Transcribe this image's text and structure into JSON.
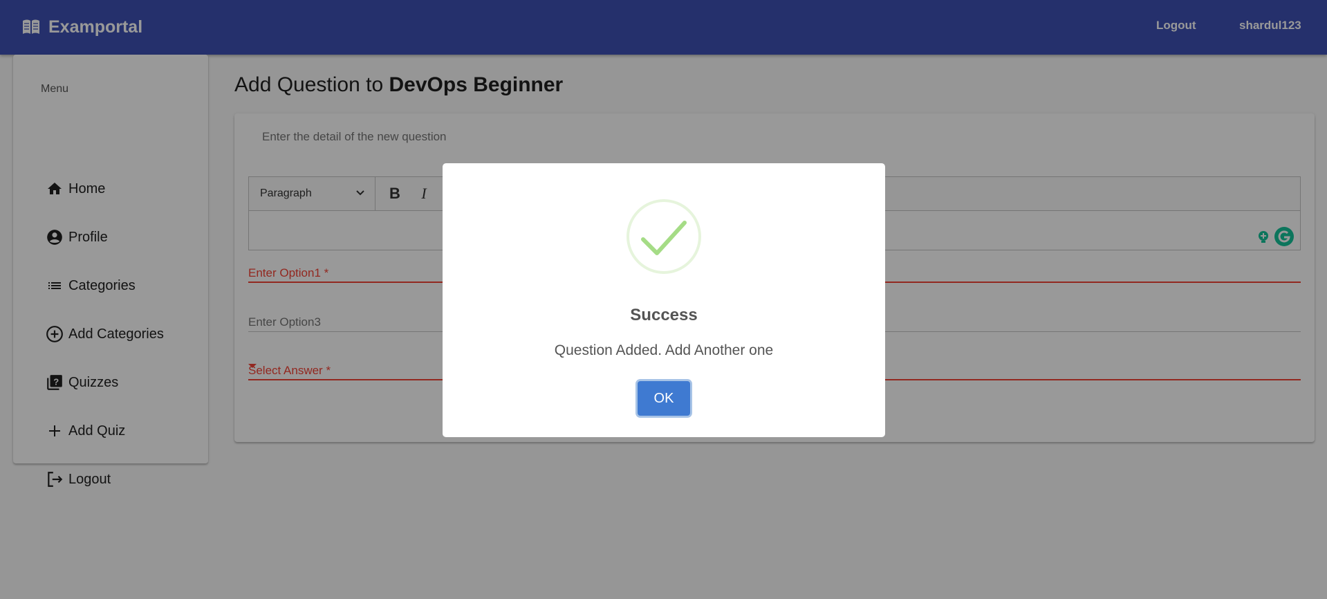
{
  "app": {
    "brand_icon": "book-icon",
    "title": "Examportal"
  },
  "header": {
    "logout_label": "Logout",
    "username": "shardul123"
  },
  "sidebar": {
    "menu_label": "Menu",
    "items": [
      {
        "label": "Home",
        "icon": "home-icon"
      },
      {
        "label": "Profile",
        "icon": "account-circle-icon"
      },
      {
        "label": "Categories",
        "icon": "list-icon"
      },
      {
        "label": "Add Categories",
        "icon": "add-circle-icon"
      },
      {
        "label": "Quizzes",
        "icon": "quiz-icon"
      },
      {
        "label": "Add Quiz",
        "icon": "plus-icon"
      },
      {
        "label": "Logout",
        "icon": "logout-icon"
      }
    ]
  },
  "main": {
    "title_prefix": "Add Question to",
    "quiz_name": "DevOps Beginner",
    "card_subtitle": "Enter the detail of the new question",
    "editor": {
      "heading_value": "Paragraph",
      "bold_label": "B",
      "italic_label": "I"
    },
    "fields": {
      "option1_placeholder": "Enter Option1 *",
      "option3_placeholder": "Enter Option3",
      "answer_placeholder": "Select Answer *"
    }
  },
  "dialog": {
    "icon": "success-check-icon",
    "title": "Success",
    "message": "Question Added. Add Another one",
    "ok_label": "OK"
  },
  "colors": {
    "primary": "#3f51b5",
    "error": "#f44336",
    "success": "#a5dc86",
    "ok_button": "#3f7ad1"
  }
}
